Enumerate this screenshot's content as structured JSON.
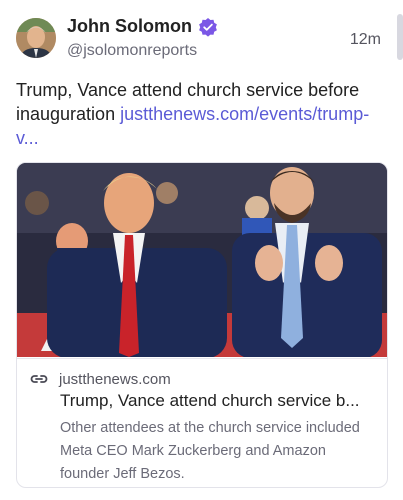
{
  "author": {
    "name": "John Solomon",
    "handle": "@jsolomonreports",
    "verified": true,
    "avatar_icon": "avatar-photo"
  },
  "post": {
    "time": "12m",
    "text": "Trump, Vance attend church service before inauguration ",
    "link_text": "justthenews.com/events/trump-v..."
  },
  "card": {
    "domain": "justthenews.com",
    "title": "Trump, Vance attend church service b...",
    "description": "Other attendees at the church service included Meta CEO Mark Zuckerberg and Amazon founder Jeff Bezos.",
    "link_icon": "link-icon",
    "image_icon": "news-photo"
  },
  "colors": {
    "link": "#5b5bd6",
    "verified_badge": "#7b57e6"
  }
}
